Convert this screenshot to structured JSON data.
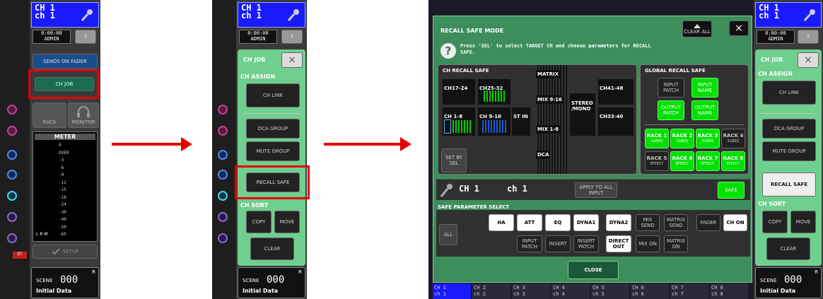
{
  "panel1": {
    "ch_num": "CH 1",
    "ch_name": "ch 1",
    "time": "0:00:00",
    "user": "ADMIN",
    "help": "?",
    "sends_on_fader": "SENDS ON FADER",
    "ch_job": "CH JOB",
    "rack": "RACK",
    "monitor": "MONITOR",
    "meter_title": "METER",
    "meter_scale": [
      "0",
      "OVER",
      "-3",
      "-6",
      "-9",
      "-12",
      "-15",
      "-18",
      "-24",
      "-30",
      "-40",
      "-50",
      "-60"
    ],
    "meter_lrm": "L R M",
    "setup": "SETUP",
    "scene_label": "SCENE",
    "scene_num": "000",
    "scene_r": "R",
    "scene_name": "Initial Data",
    "st": "ST"
  },
  "panel2": {
    "ch_num": "CH 1",
    "ch_name": "ch 1",
    "time": "0:00:00",
    "user": "ADMIN",
    "help": "?",
    "ch_job": "CH JOB",
    "close": "×",
    "ch_assign": "CH ASSIGN",
    "ch_link": "CH LINK",
    "dca_group": "DCA GROUP",
    "mute_group": "MUTE GROUP",
    "recall_safe": "RECALL SAFE",
    "ch_sort": "CH SORT",
    "copy": "COPY",
    "move": "MOVE",
    "clear": "CLEAR",
    "scene_label": "SCENE",
    "scene_num": "000",
    "scene_r": "R",
    "scene_name": "Initial Data"
  },
  "dialog": {
    "title": "RECALL SAFE MODE",
    "clear_all": "CLEAR ALL",
    "close_x": "×",
    "instruction": "Press 'SEL' to select TARGET CH and choose parameters for RECALL SAFE.",
    "ch_recall_safe": "CH RECALL SAFE",
    "global_recall_safe": "GLOBAL RECALL SAFE",
    "groups": {
      "ch17_24": "CH17-24",
      "ch25_32": "CH25-32",
      "ch1_8": "CH 1-8",
      "ch9_16": "CH 9-16",
      "st_in": "ST IN",
      "matrix": "MATRIX",
      "mix9_16": "MIX 9-16",
      "mix1_8": "MIX 1-8",
      "dca": "DCA",
      "stereo_mono": "STEREO /MONO",
      "ch41_48": "CH41-48",
      "ch33_40": "CH33-40"
    },
    "set_by_sel": "SET BY SEL",
    "global": {
      "input_patch": "INPUT PATCH",
      "input_name": "INPUT NAME",
      "output_patch": "OUTPUT PATCH",
      "output_name": "OUTPUT NAME",
      "racks": [
        {
          "name": "RACK 1",
          "sub": "31BEQ",
          "on": true
        },
        {
          "name": "RACK 2",
          "sub": "31BEQ",
          "on": true
        },
        {
          "name": "RACK 3",
          "sub": "31BEQ",
          "on": true
        },
        {
          "name": "RACK 4",
          "sub": "31BEQ",
          "on": false
        },
        {
          "name": "RACK 5",
          "sub": "EFFECT",
          "on": false
        },
        {
          "name": "RACK 6",
          "sub": "EFFECT",
          "on": true
        },
        {
          "name": "RACK 7",
          "sub": "EFFECT",
          "on": true
        },
        {
          "name": "RACK 8",
          "sub": "EFFECT",
          "on": true
        }
      ]
    },
    "sel_ch_num": "CH 1",
    "sel_ch_name": "ch 1",
    "apply_all": "APPLY TO ALL INPUT",
    "safe": "SAFE",
    "param_select": "SAFE PARAMETER SELECT",
    "params": {
      "all": "ALL",
      "ha": "HA",
      "att": "ATT",
      "eq": "EQ",
      "dyna1": "DYNA1",
      "dyna2": "DYNA2",
      "mix_send": "MIX SEND",
      "matrix_send": "MATRIX SEND",
      "fader": "FADER",
      "ch_on": "CH ON",
      "input_patch": "INPUT PATCH",
      "insert": "INSERT",
      "insert_patch": "INSERT PATCH",
      "direct_out": "DIRECT OUT",
      "mix_on": "MIX ON",
      "matrix_on": "MATRIX ON"
    },
    "close_btn": "CLOSE",
    "bottom_channels": [
      {
        "num": "CH 1",
        "name": "ch 1"
      },
      {
        "num": "CH 2",
        "name": "ch 2"
      },
      {
        "num": "CH 3",
        "name": "ch 3"
      },
      {
        "num": "CH 4",
        "name": "ch 4"
      },
      {
        "num": "CH 5",
        "name": "ch 5"
      },
      {
        "num": "CH 6",
        "name": "ch 6"
      },
      {
        "num": "CH 7",
        "name": "ch 7"
      },
      {
        "num": "CH 8",
        "name": "ch 8"
      }
    ]
  },
  "panel4": {
    "ch_num": "CH 1",
    "ch_name": "ch 1",
    "time": "0:00:00",
    "user": "ADMIN",
    "help": "?",
    "ch_job": "CH JOB",
    "close": "×",
    "ch_assign": "CH ASSIGN",
    "ch_link": "CH LINK",
    "dca_group": "DCA GROUP",
    "mute_group": "MUTE GROUP",
    "recall_safe": "RECALL SAFE",
    "ch_sort": "CH SORT",
    "copy": "COPY",
    "move": "MOVE",
    "clear": "CLEAR",
    "scene_label": "SCENE",
    "scene_num": "000",
    "scene_r": "R",
    "scene_name": "Initial Data"
  },
  "colors": {
    "highlight": "#e30000",
    "green_panel": "#6fcf8e",
    "ch_header": "#1a1aff",
    "safe_on": "#00e000"
  }
}
